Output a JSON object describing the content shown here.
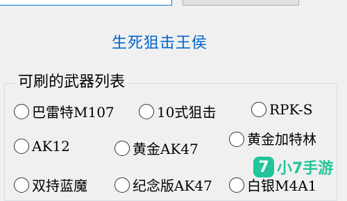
{
  "header": {
    "input_value": "",
    "button_label": ""
  },
  "link_title": "生死狙击王侯",
  "group": {
    "legend": "可刷的武器列表",
    "options": [
      {
        "label": "巴雷特M107"
      },
      {
        "label": "10式狙击"
      },
      {
        "label": "RPK-S"
      },
      {
        "label": "AK12"
      },
      {
        "label": "黄金AK47"
      },
      {
        "label": "黄金加特林"
      },
      {
        "label": "双持蓝魔"
      },
      {
        "label": "纪念版AK47"
      },
      {
        "label": "白银M4A1"
      }
    ]
  },
  "watermark": {
    "badge": "7",
    "text": "小7手游"
  }
}
